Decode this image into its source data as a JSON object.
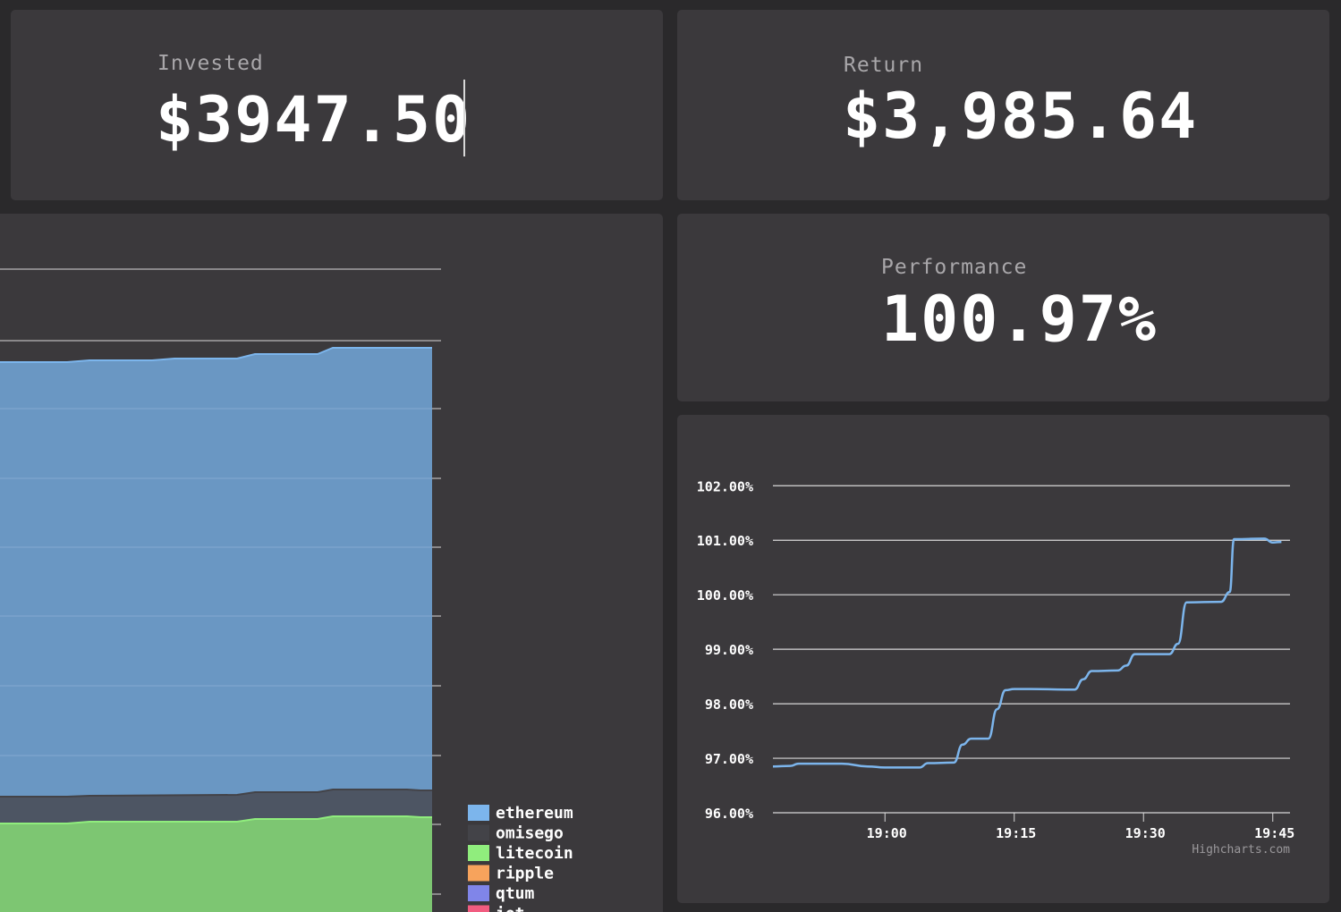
{
  "invested": {
    "label": "Invested",
    "value": "$3947.50"
  },
  "return": {
    "label": "Return",
    "value": "$3,985.64"
  },
  "performance": {
    "label": "Performance",
    "value": "100.97%"
  },
  "colors": {
    "background": "#2a292b",
    "panel": "#3b393c",
    "line": "#7cb5ec",
    "ethereum": "#7cb5ec",
    "omisego": "#434348",
    "litecoin": "#90ed7d",
    "ripple": "#f7a35c",
    "qtum": "#8085e9",
    "other": "#f15c80"
  },
  "portfolio_chart": {
    "legend": [
      {
        "name": "ethereum",
        "color": "#7cb5ec"
      },
      {
        "name": "omisego",
        "color": "#434348"
      },
      {
        "name": "litecoin",
        "color": "#90ed7d"
      },
      {
        "name": "ripple",
        "color": "#f7a35c"
      },
      {
        "name": "qtum",
        "color": "#8085e9"
      },
      {
        "name": "iot",
        "color": "#f15c80"
      }
    ]
  },
  "chart_data": {
    "type": "line",
    "title": "",
    "xlabel": "",
    "ylabel": "",
    "x_ticks": [
      "19:00",
      "19:15",
      "19:30",
      "19:45"
    ],
    "y_ticks": [
      "96.00%",
      "97.00%",
      "98.00%",
      "99.00%",
      "100.00%",
      "101.00%",
      "102.00%"
    ],
    "ylim": [
      96,
      102.3
    ],
    "xlim": [
      "18:47",
      "19:47"
    ],
    "grid": true,
    "credits": "Highcharts.com",
    "series": [
      {
        "x": [
          "18:47",
          "18:49",
          "18:50",
          "18:51",
          "18:55",
          "18:58",
          "19:00",
          "19:03",
          "19:04",
          "19:05",
          "19:08",
          "19:09",
          "19:10",
          "19:12",
          "19:13",
          "19:14",
          "19:15",
          "19:17",
          "19:21",
          "19:22",
          "19:23",
          "19:24",
          "19:27",
          "19:28",
          "19:29",
          "19:33",
          "19:34",
          "19:35",
          "19:39",
          "19:40",
          "19:40.5",
          "19:44",
          "19:45",
          "19:46"
        ],
        "values": [
          96.85,
          96.86,
          96.9,
          96.9,
          96.9,
          96.85,
          96.83,
          96.83,
          96.83,
          96.91,
          96.92,
          97.25,
          97.36,
          97.36,
          97.9,
          98.25,
          98.27,
          98.27,
          98.26,
          98.26,
          98.45,
          98.6,
          98.61,
          98.7,
          98.91,
          98.91,
          99.1,
          99.86,
          99.87,
          100.05,
          101.02,
          101.03,
          100.96,
          100.97
        ]
      }
    ]
  }
}
